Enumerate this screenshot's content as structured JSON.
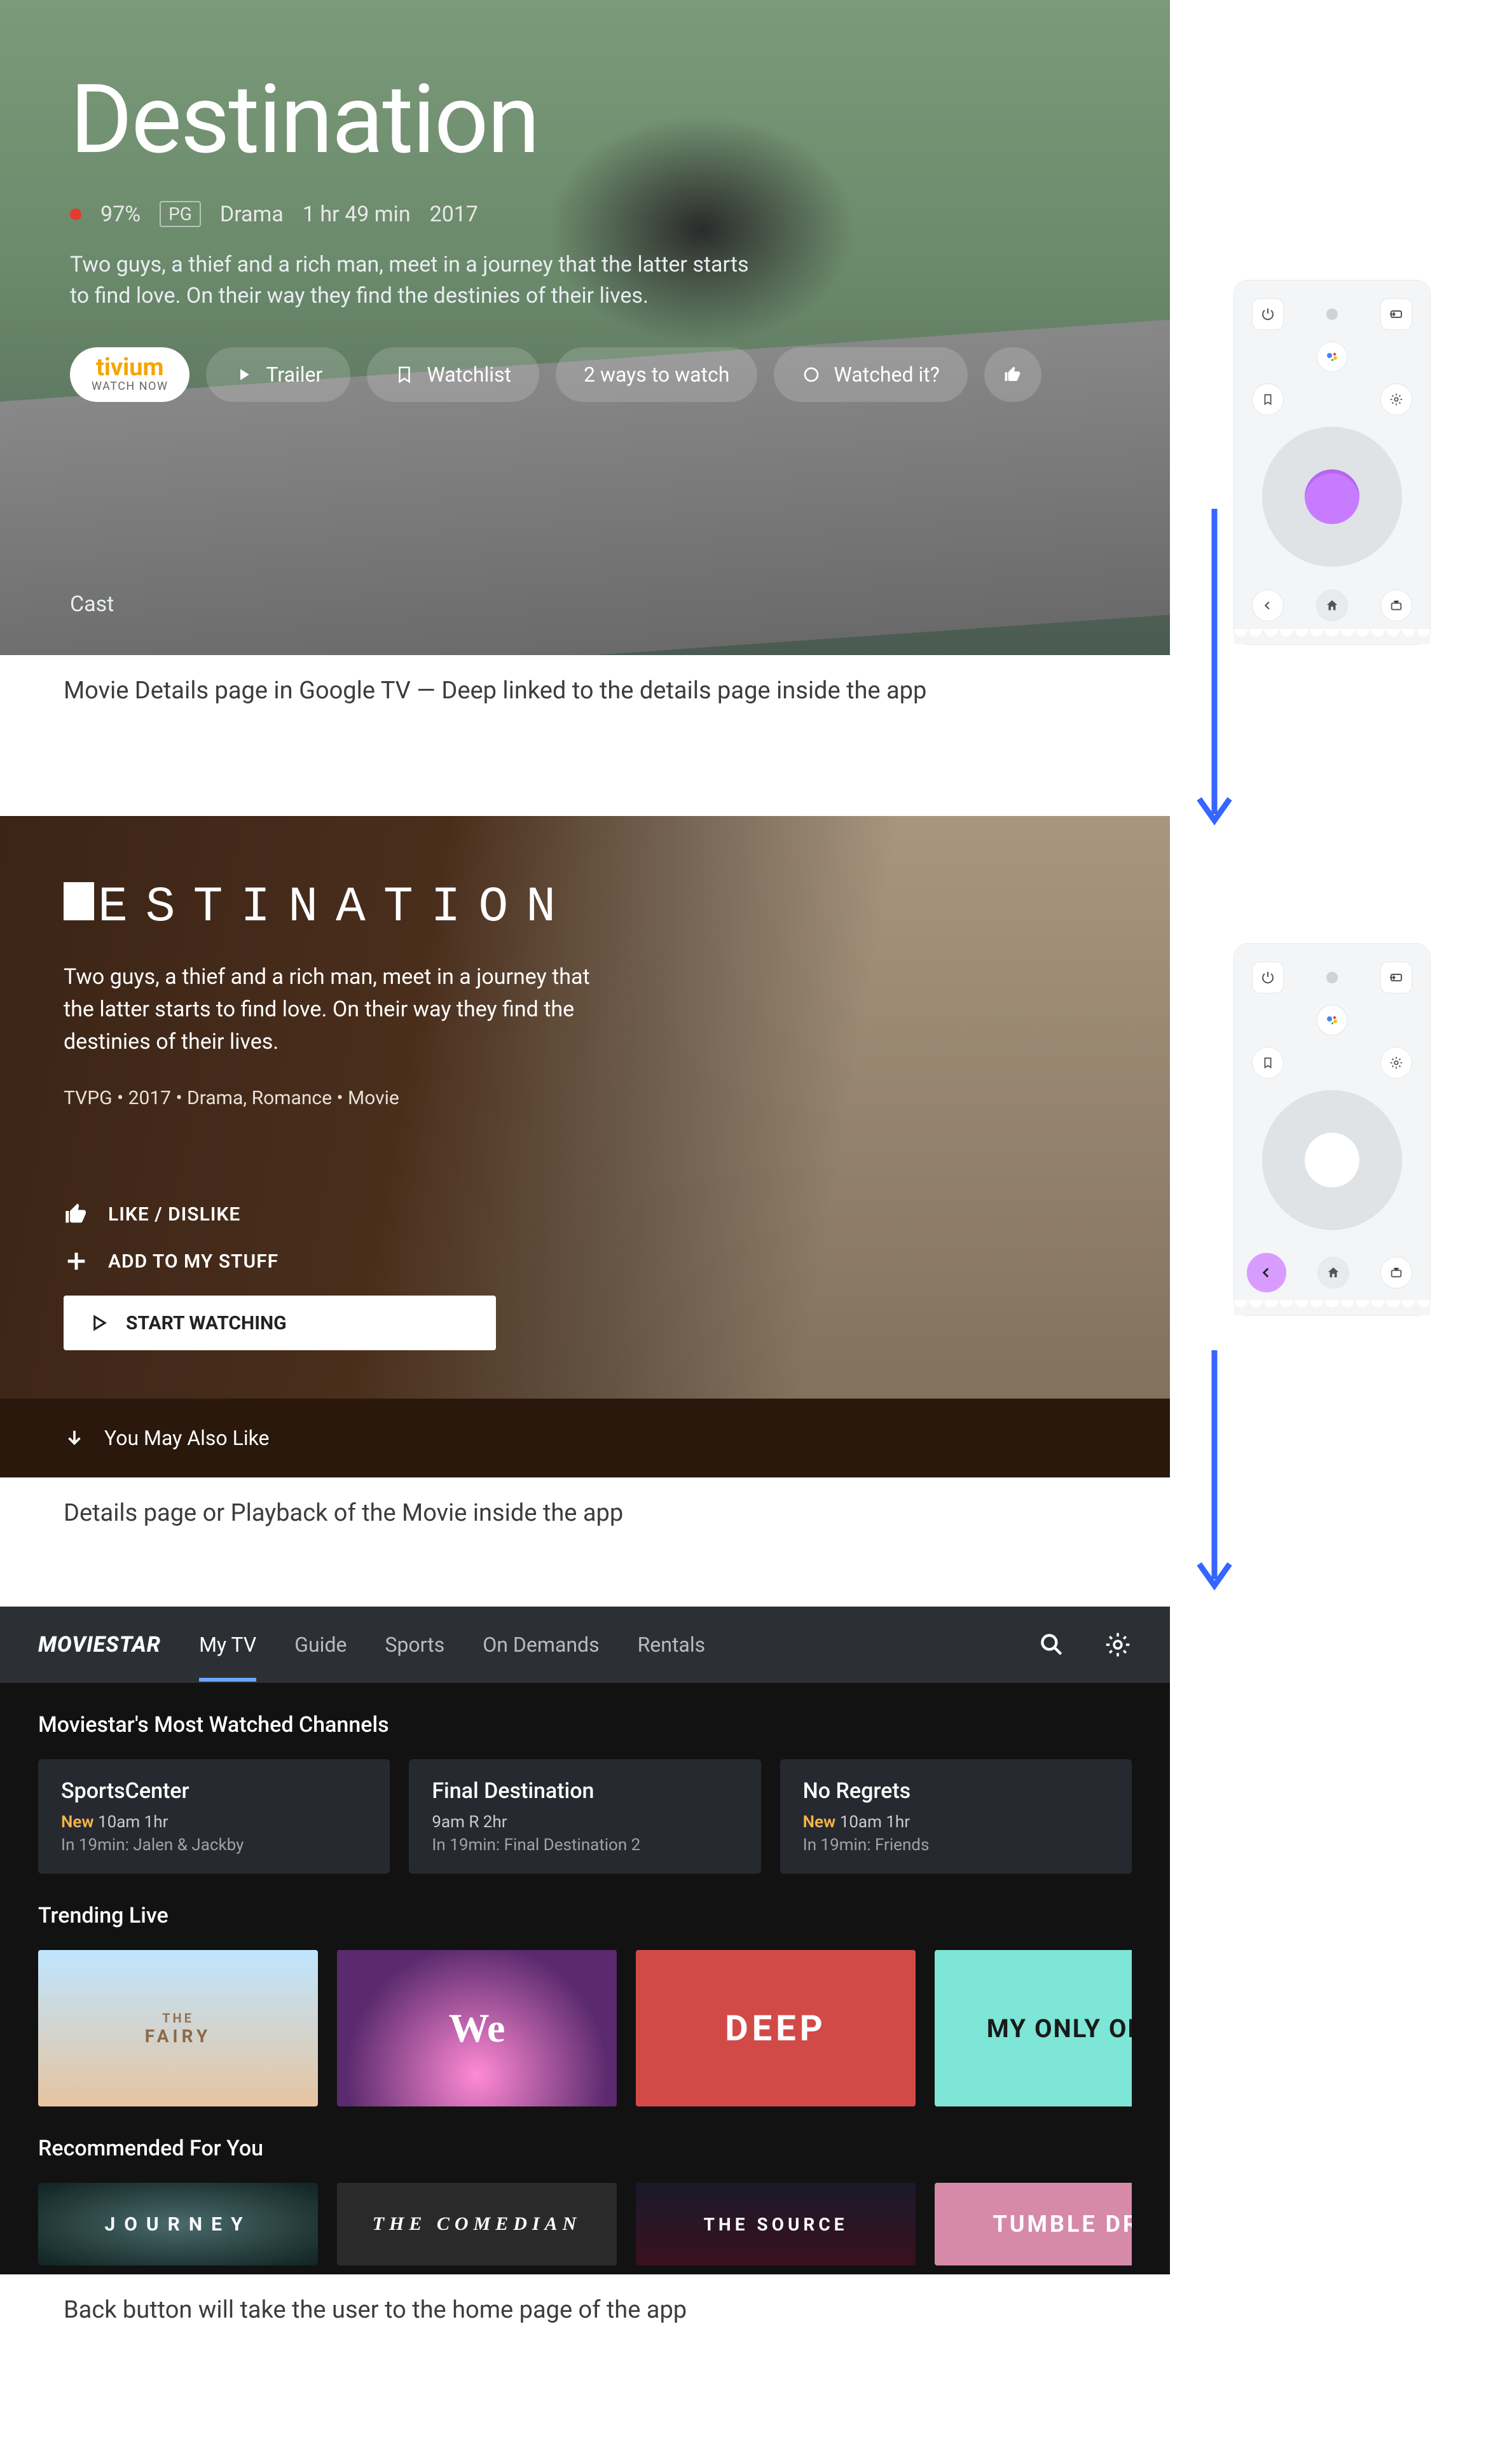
{
  "gtv": {
    "title": "Destination",
    "score": "97%",
    "rating": "PG",
    "genre": "Drama",
    "runtime": "1 hr 49 min",
    "year": "2017",
    "description": "Two guys, a thief and a rich man, meet in a journey that the latter starts to find love. On their way they find the destinies of their lives.",
    "primary_brand": "tivium",
    "primary_sub": "WATCH NOW",
    "actions": {
      "trailer": "Trailer",
      "watchlist": "Watchlist",
      "ways": "2 ways to watch",
      "watched": "Watched it?"
    },
    "cast_label": "Cast"
  },
  "app": {
    "title_rest": "ESTINATION",
    "description": "Two guys, a thief and a rich man, meet in a journey that the latter starts to find love. On their way they find the destinies of their lives.",
    "meta": "TVPG • 2017 • Drama, Romance • Movie",
    "like_label": "LIKE / DISLIKE",
    "add_label": "ADD TO MY STUFF",
    "start_label": "START WATCHING",
    "footer": "You May Also Like"
  },
  "home": {
    "logo": "MOVIESTAR",
    "tabs": [
      "My TV",
      "Guide",
      "Sports",
      "On Demands",
      "Rentals"
    ],
    "section1_title": "Moviestar's Most Watched Channels",
    "cards": [
      {
        "title": "SportsCenter",
        "new": "New",
        "time": "10am 1hr",
        "next": "In 19min: Jalen & Jackby"
      },
      {
        "title": "Final Destination",
        "new": "",
        "time": "9am R 2hr",
        "next": "In 19min: Final Destination 2"
      },
      {
        "title": "No Regrets",
        "new": "New",
        "time": "10am 1hr",
        "next": "In 19min: Friends"
      }
    ],
    "section2_title": "Trending Live",
    "posters2": [
      "FAIRY",
      "We",
      "DEEP",
      "MY ONLY ONE"
    ],
    "section3_title": "Recommended For You",
    "posters3": [
      "JOURNEY",
      "THE COMEDIAN",
      "THE SOURCE",
      "TUMBLE DRY"
    ]
  },
  "captions": {
    "c1": "Movie Details page in Google TV — Deep linked to the details page inside the app",
    "c2": "Details page or Playback of the Movie inside the app",
    "c3": "Back button will take the user to the home page of the app"
  }
}
